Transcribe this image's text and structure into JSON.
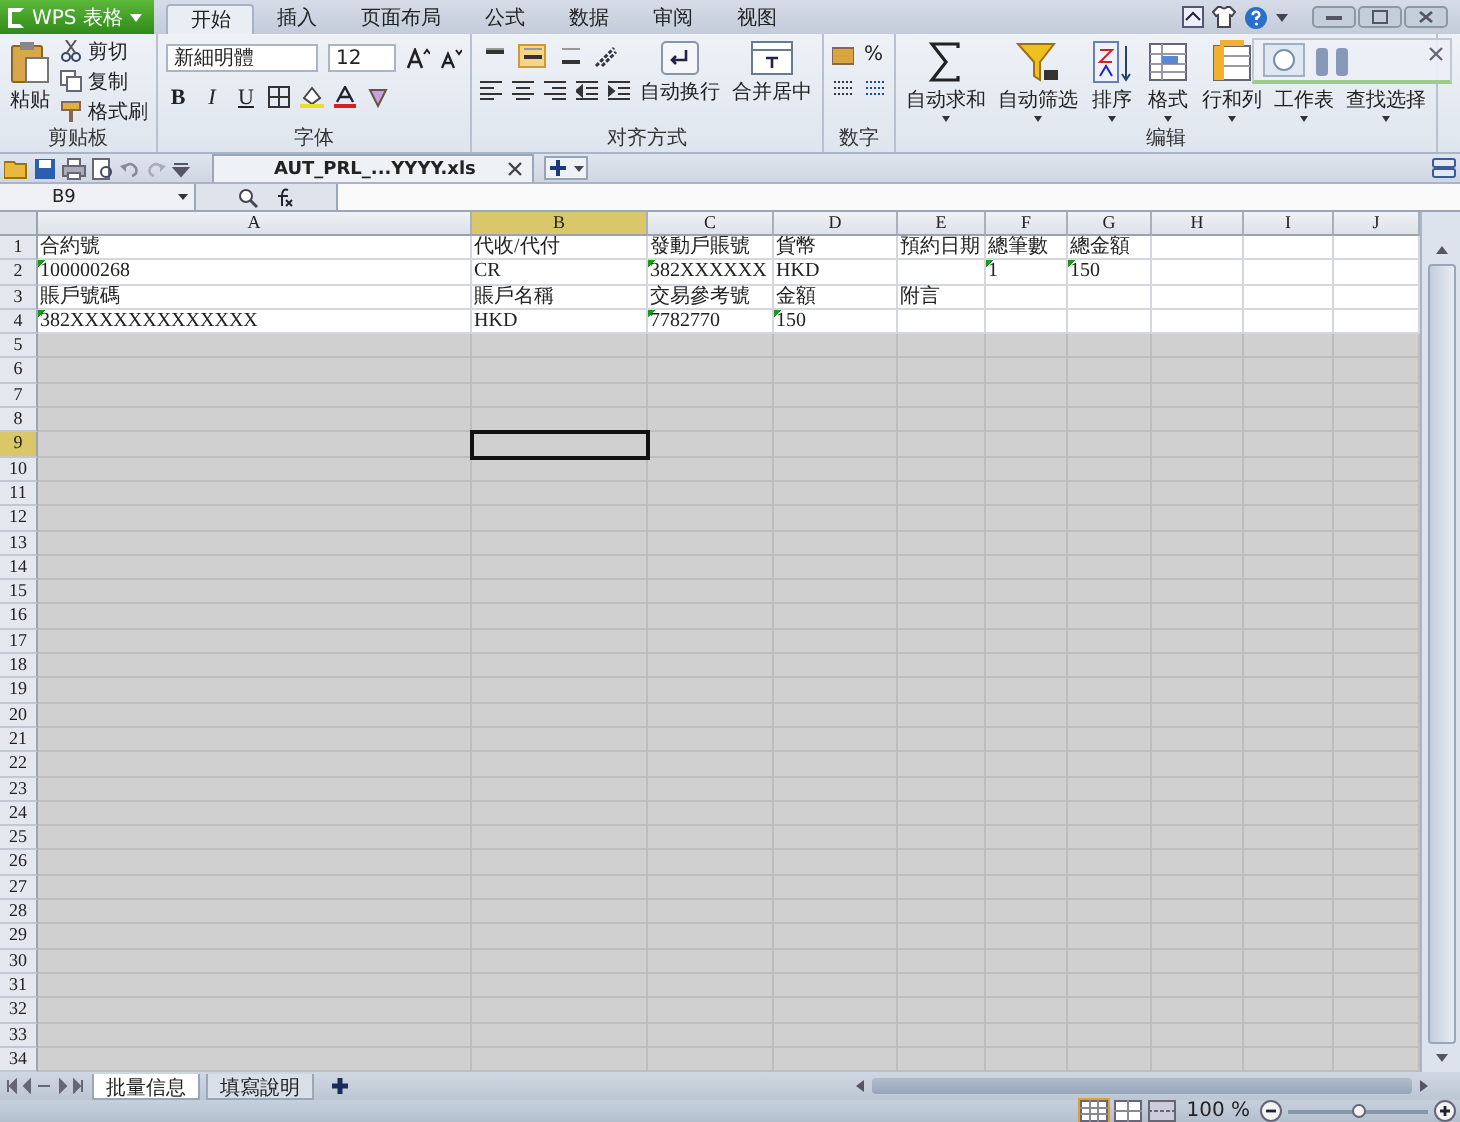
{
  "app_menu": {
    "label": "WPS 表格"
  },
  "ribbon_tabs": [
    {
      "label": "开始",
      "selected": true
    },
    {
      "label": "插入",
      "selected": false
    },
    {
      "label": "页面布局",
      "selected": false
    },
    {
      "label": "公式",
      "selected": false
    },
    {
      "label": "数据",
      "selected": false
    },
    {
      "label": "审阅",
      "selected": false
    },
    {
      "label": "视图",
      "selected": false
    }
  ],
  "clipboard": {
    "paste": "粘贴",
    "cut": "剪切",
    "copy": "复制",
    "format_painter": "格式刷",
    "group_label": "剪贴板"
  },
  "font": {
    "name": "新細明體",
    "size": "12",
    "bold": "B",
    "italic": "I",
    "underline": "U",
    "group_label": "字体"
  },
  "alignment": {
    "buttons": [
      {
        "kind": "top",
        "selected": false
      },
      {
        "kind": "middle",
        "selected": true
      },
      {
        "kind": "bottom",
        "selected": false
      }
    ],
    "wrap": "自动换行",
    "merge": "合并居中",
    "group_label": "对齐方式"
  },
  "number": {
    "percent": "%",
    "group_label": "数字"
  },
  "editing": {
    "buttons": [
      {
        "label": "自动求和",
        "kind": "sum"
      },
      {
        "label": "自动筛选",
        "kind": "filter"
      },
      {
        "label": "排序",
        "kind": "sort"
      },
      {
        "label": "格式",
        "kind": "format"
      },
      {
        "label": "行和列",
        "kind": "rows"
      },
      {
        "label": "工作表",
        "kind": "sheet"
      },
      {
        "label": "查找选择",
        "kind": "find"
      }
    ],
    "group_label": "编辑"
  },
  "document_tab": {
    "label": "AUT_PRL_...YYYY.xls"
  },
  "formula_bar": {
    "name_box": "B9"
  },
  "columns": [
    {
      "label": "A",
      "selected": false
    },
    {
      "label": "B",
      "selected": true
    },
    {
      "label": "C",
      "selected": false
    },
    {
      "label": "D",
      "selected": false
    },
    {
      "label": "E",
      "selected": false
    },
    {
      "label": "F",
      "selected": false
    },
    {
      "label": "G",
      "selected": false
    },
    {
      "label": "H",
      "selected": false
    },
    {
      "label": "I",
      "selected": false
    },
    {
      "label": "J",
      "selected": false
    }
  ],
  "rows": [
    {
      "number": "1",
      "selected": false,
      "shaded": false,
      "cells": [
        {
          "text": "合約號",
          "warning": false
        },
        {
          "text": "代收/代付",
          "warning": false
        },
        {
          "text": "發動戶賬號",
          "warning": false
        },
        {
          "text": "貨幣",
          "warning": false
        },
        {
          "text": "預約日期",
          "warning": false
        },
        {
          "text": "總筆數",
          "warning": false
        },
        {
          "text": "總金額",
          "warning": false
        },
        {},
        {},
        {}
      ]
    },
    {
      "number": "2",
      "selected": false,
      "shaded": false,
      "cells": [
        {
          "text": "100000268",
          "warning": true
        },
        {
          "text": "CR",
          "warning": false
        },
        {
          "text": "382XXXXXX",
          "warning": true
        },
        {
          "text": "HKD",
          "warning": false
        },
        {},
        {
          "text": "1",
          "warning": true
        },
        {
          "text": "150",
          "warning": true
        },
        {},
        {},
        {}
      ]
    },
    {
      "number": "3",
      "selected": false,
      "shaded": false,
      "cells": [
        {
          "text": "賬戶號碼",
          "warning": false
        },
        {
          "text": "賬戶名稱",
          "warning": false
        },
        {
          "text": "交易參考號",
          "warning": false
        },
        {
          "text": "金額",
          "warning": false
        },
        {
          "text": "附言",
          "warning": false
        },
        {},
        {},
        {},
        {},
        {}
      ]
    },
    {
      "number": "4",
      "selected": false,
      "shaded": false,
      "cells": [
        {
          "text": "382XXXXXXXXXXXXX",
          "warning": true
        },
        {
          "text": "HKD",
          "warning": false
        },
        {
          "text": "7782770",
          "warning": true
        },
        {
          "text": "150",
          "warning": true
        },
        {},
        {},
        {},
        {},
        {},
        {}
      ]
    },
    {
      "number": "5",
      "selected": false,
      "shaded": true
    },
    {
      "number": "6",
      "selected": false,
      "shaded": true
    },
    {
      "number": "7",
      "selected": false,
      "shaded": true
    },
    {
      "number": "8",
      "selected": false,
      "shaded": true
    },
    {
      "number": "9",
      "selected": true,
      "shaded": true
    },
    {
      "number": "10",
      "selected": false,
      "shaded": true
    },
    {
      "number": "11",
      "selected": false,
      "shaded": true
    },
    {
      "number": "12",
      "selected": false,
      "shaded": true
    },
    {
      "number": "13",
      "selected": false,
      "shaded": true
    },
    {
      "number": "14",
      "selected": false,
      "shaded": true
    },
    {
      "number": "15",
      "selected": false,
      "shaded": true
    },
    {
      "number": "16",
      "selected": false,
      "shaded": true
    },
    {
      "number": "17",
      "selected": false,
      "shaded": true
    },
    {
      "number": "18",
      "selected": false,
      "shaded": true
    },
    {
      "number": "19",
      "selected": false,
      "shaded": true
    },
    {
      "number": "20",
      "selected": false,
      "shaded": true
    },
    {
      "number": "21",
      "selected": false,
      "shaded": true
    },
    {
      "number": "22",
      "selected": false,
      "shaded": true
    },
    {
      "number": "23",
      "selected": false,
      "shaded": true
    },
    {
      "number": "24",
      "selected": false,
      "shaded": true
    },
    {
      "number": "25",
      "selected": false,
      "shaded": true
    },
    {
      "number": "26",
      "selected": false,
      "shaded": true
    },
    {
      "number": "27",
      "selected": false,
      "shaded": true
    },
    {
      "number": "28",
      "selected": false,
      "shaded": true
    },
    {
      "number": "29",
      "selected": false,
      "shaded": true
    },
    {
      "number": "30",
      "selected": false,
      "shaded": true
    },
    {
      "number": "31",
      "selected": false,
      "shaded": true
    },
    {
      "number": "32",
      "selected": false,
      "shaded": true
    },
    {
      "number": "33",
      "selected": false,
      "shaded": true
    },
    {
      "number": "34",
      "selected": false,
      "shaded": true
    }
  ],
  "sheet_tabs": [
    {
      "label": "批量信息",
      "selected": true
    },
    {
      "label": "填寫說明",
      "selected": false
    }
  ],
  "status_bar": {
    "zoom": "100 %",
    "zoom_slider": {
      "level": 0.5
    }
  }
}
